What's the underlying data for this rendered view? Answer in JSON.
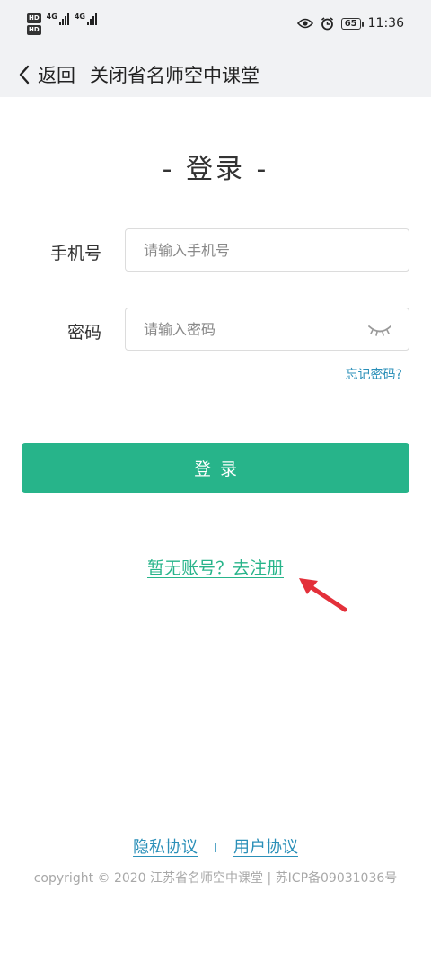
{
  "status_bar": {
    "hd_badge": "HD",
    "network_1": "4G",
    "network_2": "4G",
    "battery": "65",
    "time": "11:36",
    "icons": [
      "eye-icon",
      "alarm-icon"
    ]
  },
  "header": {
    "back_label": "返回",
    "close_label": "关闭省名师空中课堂"
  },
  "login": {
    "title": "- 登录 -",
    "phone_label": "手机号",
    "phone_placeholder": "请输入手机号",
    "password_label": "密码",
    "password_placeholder": "请输入密码",
    "forgot_password": "忘记密码?",
    "submit_label": "登录",
    "register_link": "暂无账号？去注册"
  },
  "footer": {
    "privacy": "隐私协议",
    "separator": "I",
    "user_agreement": "用户协议",
    "copyright": "copyright © 2020 江苏省名师空中课堂 | 苏ICP备09031036号"
  },
  "colors": {
    "accent": "#27b48a",
    "link": "#2a8fb8",
    "header_bg": "#f1f2f4",
    "arrow": "#e3303a"
  }
}
